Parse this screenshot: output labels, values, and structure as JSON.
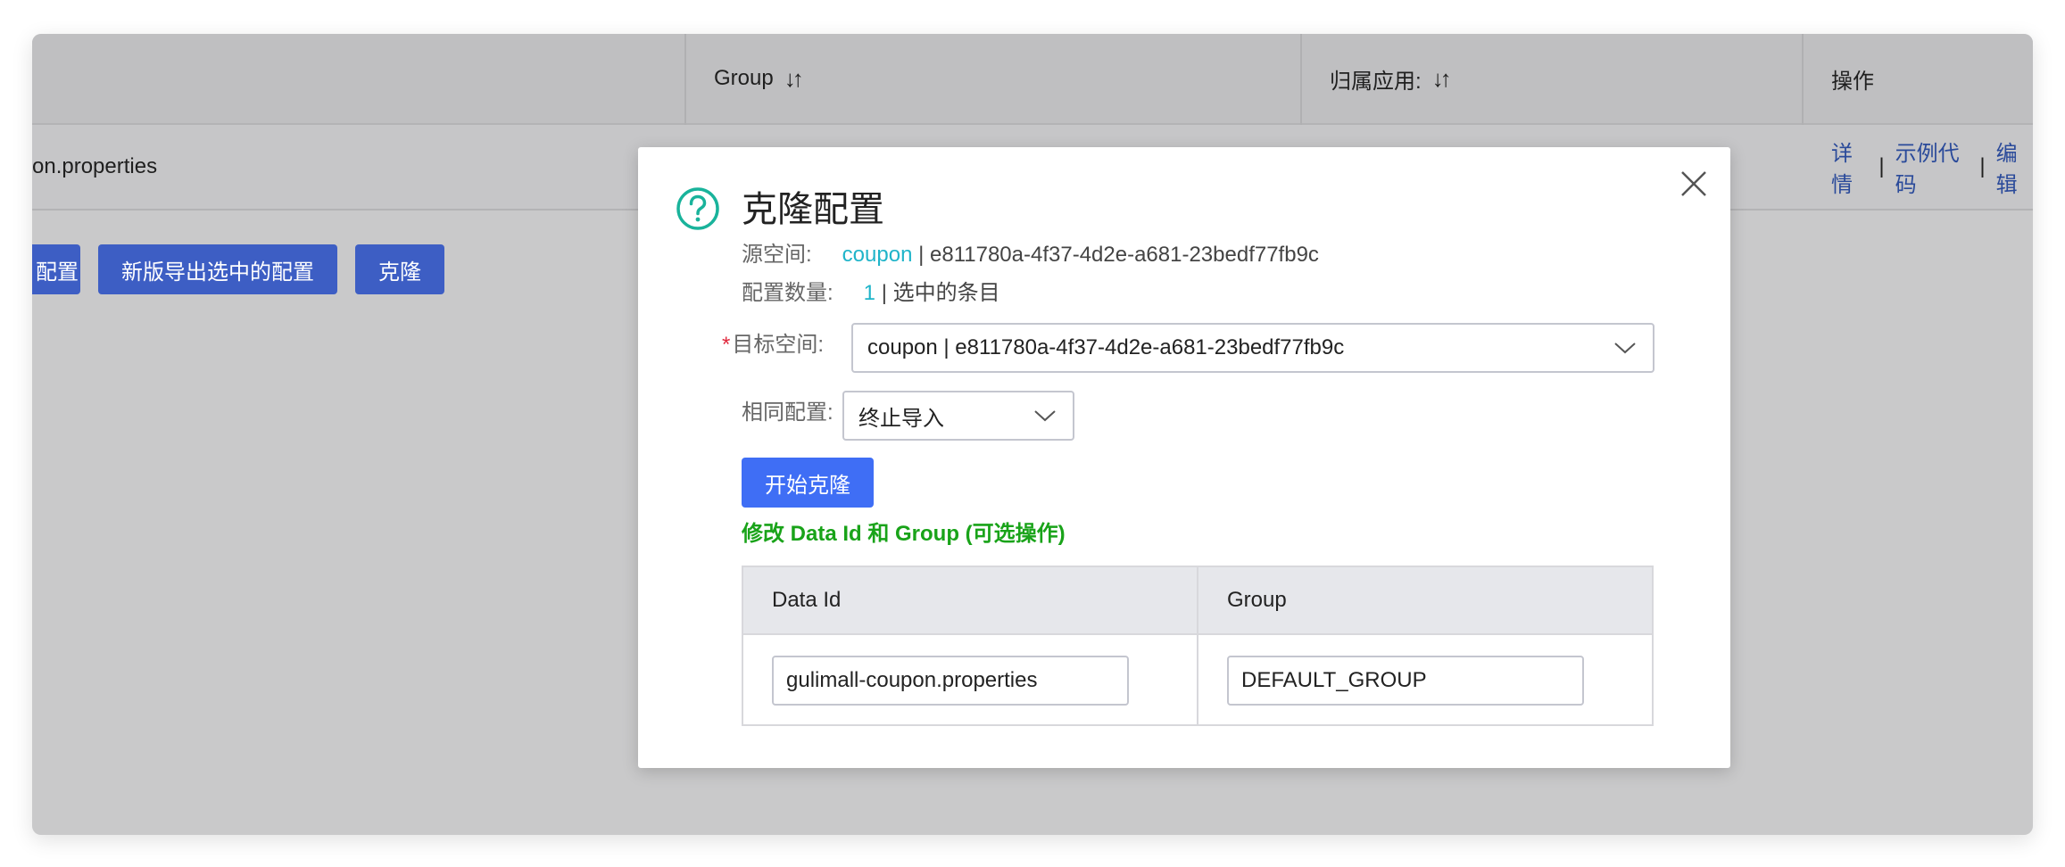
{
  "background": {
    "table_headers": {
      "group": "Group",
      "app": "归属应用:",
      "ops": "操作"
    },
    "row": {
      "data_id_fragment": "on.properties",
      "ops": {
        "detail": "详情",
        "sample_code": "示例代码",
        "edit": "编辑",
        "separator": "|"
      }
    },
    "buttons": {
      "partial": "配置",
      "export_new": "新版导出选中的配置",
      "clone": "克隆"
    }
  },
  "modal": {
    "title": "克隆配置",
    "source_label": "源空间:",
    "source_name": "coupon",
    "source_sep_id": "| e811780a-4f37-4d2e-a681-23bedf77fb9c",
    "count_label": "配置数量:",
    "count_value": "1",
    "count_suffix": "| 选中的条目",
    "target_label": "目标空间:",
    "target_required_mark": "*",
    "target_value": "coupon | e811780a-4f37-4d2e-a681-23bedf77fb9c",
    "same_label": "相同配置:",
    "same_value": "终止导入",
    "start_button": "开始克隆",
    "modify_title": "修改 Data Id 和 Group (可选操作)",
    "table": {
      "col_data_id": "Data Id",
      "col_group": "Group",
      "data_id_value": "gulimall-coupon.properties",
      "group_value": "DEFAULT_GROUP"
    }
  },
  "colors": {
    "primary": "#3f6ef5",
    "accent": "#1fb4c9",
    "success_text": "#19a319",
    "required": "#e0283d",
    "overlay": "#c9c9ca"
  },
  "icons": {
    "help": "question-circle-icon",
    "close": "close-icon",
    "chevron": "chevron-down-icon",
    "sort": "sort-icon"
  }
}
